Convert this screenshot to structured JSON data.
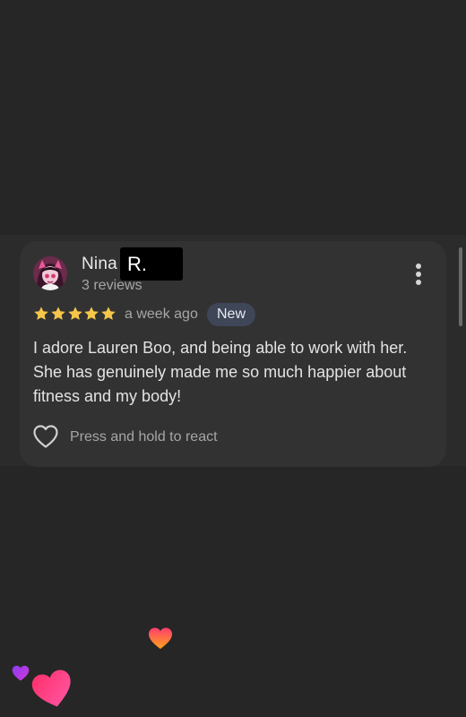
{
  "review": {
    "author_first_name": "Nina",
    "author_last_initial": "R.",
    "review_count": "3 reviews",
    "rating": 5,
    "rating_max": 5,
    "time_ago": "a week ago",
    "badge": "New",
    "text": "I adore Lauren Boo, and being able to work with her. She has genuinely made me so much happier about fitness and my body!",
    "react_label": "Press and hold to react"
  },
  "icons": {
    "avatar": "cartoon-character-avatar",
    "more": "more-vertical-icon",
    "star": "star-icon",
    "react": "heart-outline-icon",
    "floating": "heart-icon"
  },
  "colors": {
    "background": "#262626",
    "card": "#323232",
    "star": "#f6c64a",
    "badge_bg": "#3e4658",
    "text_primary": "#e3e3e3",
    "text_secondary": "#a6a6a6"
  }
}
